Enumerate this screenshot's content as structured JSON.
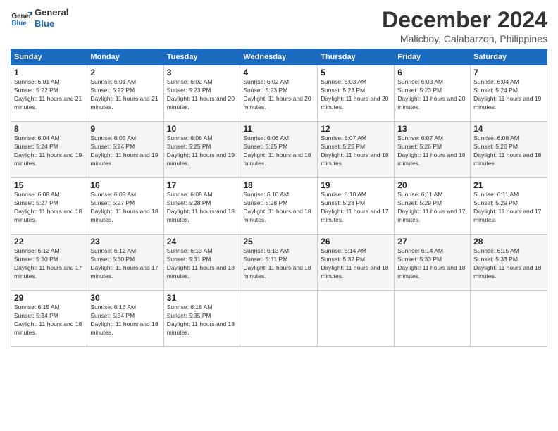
{
  "header": {
    "logo": {
      "line1": "General",
      "line2": "Blue"
    },
    "title": "December 2024",
    "location": "Malicboy, Calabarzon, Philippines"
  },
  "calendar": {
    "days_of_week": [
      "Sunday",
      "Monday",
      "Tuesday",
      "Wednesday",
      "Thursday",
      "Friday",
      "Saturday"
    ],
    "weeks": [
      [
        {
          "day": "1",
          "sunrise": "6:01 AM",
          "sunset": "5:22 PM",
          "daylight": "11 hours and 21 minutes."
        },
        {
          "day": "2",
          "sunrise": "6:01 AM",
          "sunset": "5:22 PM",
          "daylight": "11 hours and 21 minutes."
        },
        {
          "day": "3",
          "sunrise": "6:02 AM",
          "sunset": "5:23 PM",
          "daylight": "11 hours and 20 minutes."
        },
        {
          "day": "4",
          "sunrise": "6:02 AM",
          "sunset": "5:23 PM",
          "daylight": "11 hours and 20 minutes."
        },
        {
          "day": "5",
          "sunrise": "6:03 AM",
          "sunset": "5:23 PM",
          "daylight": "11 hours and 20 minutes."
        },
        {
          "day": "6",
          "sunrise": "6:03 AM",
          "sunset": "5:23 PM",
          "daylight": "11 hours and 20 minutes."
        },
        {
          "day": "7",
          "sunrise": "6:04 AM",
          "sunset": "5:24 PM",
          "daylight": "11 hours and 19 minutes."
        }
      ],
      [
        {
          "day": "8",
          "sunrise": "6:04 AM",
          "sunset": "5:24 PM",
          "daylight": "11 hours and 19 minutes."
        },
        {
          "day": "9",
          "sunrise": "6:05 AM",
          "sunset": "5:24 PM",
          "daylight": "11 hours and 19 minutes."
        },
        {
          "day": "10",
          "sunrise": "6:06 AM",
          "sunset": "5:25 PM",
          "daylight": "11 hours and 19 minutes."
        },
        {
          "day": "11",
          "sunrise": "6:06 AM",
          "sunset": "5:25 PM",
          "daylight": "11 hours and 18 minutes."
        },
        {
          "day": "12",
          "sunrise": "6:07 AM",
          "sunset": "5:25 PM",
          "daylight": "11 hours and 18 minutes."
        },
        {
          "day": "13",
          "sunrise": "6:07 AM",
          "sunset": "5:26 PM",
          "daylight": "11 hours and 18 minutes."
        },
        {
          "day": "14",
          "sunrise": "6:08 AM",
          "sunset": "5:26 PM",
          "daylight": "11 hours and 18 minutes."
        }
      ],
      [
        {
          "day": "15",
          "sunrise": "6:08 AM",
          "sunset": "5:27 PM",
          "daylight": "11 hours and 18 minutes."
        },
        {
          "day": "16",
          "sunrise": "6:09 AM",
          "sunset": "5:27 PM",
          "daylight": "11 hours and 18 minutes."
        },
        {
          "day": "17",
          "sunrise": "6:09 AM",
          "sunset": "5:28 PM",
          "daylight": "11 hours and 18 minutes."
        },
        {
          "day": "18",
          "sunrise": "6:10 AM",
          "sunset": "5:28 PM",
          "daylight": "11 hours and 18 minutes."
        },
        {
          "day": "19",
          "sunrise": "6:10 AM",
          "sunset": "5:28 PM",
          "daylight": "11 hours and 17 minutes."
        },
        {
          "day": "20",
          "sunrise": "6:11 AM",
          "sunset": "5:29 PM",
          "daylight": "11 hours and 17 minutes."
        },
        {
          "day": "21",
          "sunrise": "6:11 AM",
          "sunset": "5:29 PM",
          "daylight": "11 hours and 17 minutes."
        }
      ],
      [
        {
          "day": "22",
          "sunrise": "6:12 AM",
          "sunset": "5:30 PM",
          "daylight": "11 hours and 17 minutes."
        },
        {
          "day": "23",
          "sunrise": "6:12 AM",
          "sunset": "5:30 PM",
          "daylight": "11 hours and 17 minutes."
        },
        {
          "day": "24",
          "sunrise": "6:13 AM",
          "sunset": "5:31 PM",
          "daylight": "11 hours and 18 minutes."
        },
        {
          "day": "25",
          "sunrise": "6:13 AM",
          "sunset": "5:31 PM",
          "daylight": "11 hours and 18 minutes."
        },
        {
          "day": "26",
          "sunrise": "6:14 AM",
          "sunset": "5:32 PM",
          "daylight": "11 hours and 18 minutes."
        },
        {
          "day": "27",
          "sunrise": "6:14 AM",
          "sunset": "5:33 PM",
          "daylight": "11 hours and 18 minutes."
        },
        {
          "day": "28",
          "sunrise": "6:15 AM",
          "sunset": "5:33 PM",
          "daylight": "11 hours and 18 minutes."
        }
      ],
      [
        {
          "day": "29",
          "sunrise": "6:15 AM",
          "sunset": "5:34 PM",
          "daylight": "11 hours and 18 minutes."
        },
        {
          "day": "30",
          "sunrise": "6:16 AM",
          "sunset": "5:34 PM",
          "daylight": "11 hours and 18 minutes."
        },
        {
          "day": "31",
          "sunrise": "6:16 AM",
          "sunset": "5:35 PM",
          "daylight": "11 hours and 18 minutes."
        },
        null,
        null,
        null,
        null
      ]
    ]
  }
}
